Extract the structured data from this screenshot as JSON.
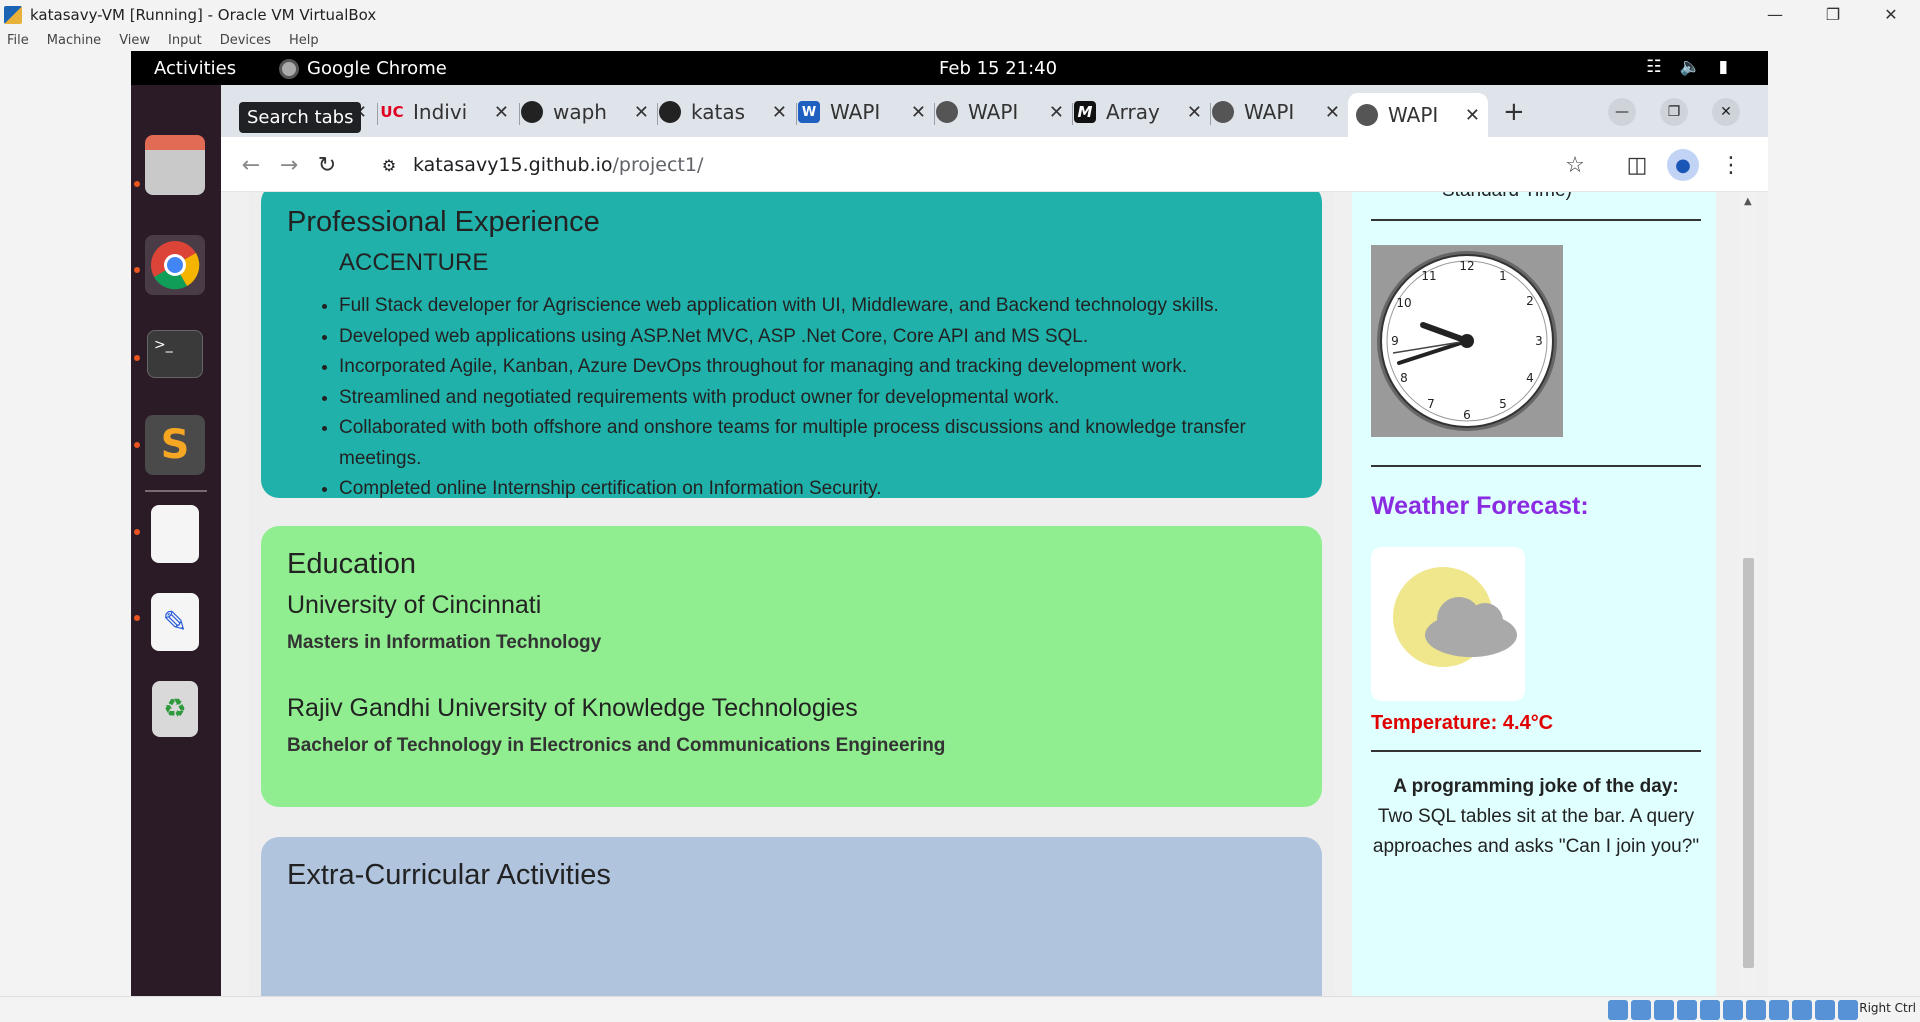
{
  "vbox": {
    "title": "katasavy-VM [Running] - Oracle VM VirtualBox",
    "menu": [
      "File",
      "Machine",
      "View",
      "Input",
      "Devices",
      "Help"
    ],
    "host_key": "Right Ctrl"
  },
  "gnome": {
    "activities": "Activities",
    "app_name": "Google Chrome",
    "datetime": "Feb 15  21:40"
  },
  "chrome": {
    "tooltip": "Search tabs",
    "tabs": [
      {
        "label": "",
        "icon": "blank"
      },
      {
        "label": "Indivi",
        "icon": "uc-logo"
      },
      {
        "label": "waph",
        "icon": "github-icon"
      },
      {
        "label": "katas",
        "icon": "github-icon"
      },
      {
        "label": "WAPI",
        "icon": "word-icon"
      },
      {
        "label": "WAPI",
        "icon": "globe-icon"
      },
      {
        "label": "Array",
        "icon": "m-icon"
      },
      {
        "label": "WAPI",
        "icon": "globe-icon"
      },
      {
        "label": "WAPI",
        "icon": "globe-icon"
      }
    ],
    "url_host": "katasavy15.github.io",
    "url_path": "/project1/"
  },
  "page": {
    "experience": {
      "heading": "Professional Experience",
      "company": "ACCENTURE",
      "items": [
        "Full Stack developer for Agriscience web application with UI, Middleware, and Backend technology skills.",
        "Developed web applications using ASP.Net MVC, ASP .Net Core, Core API and MS SQL.",
        "Incorporated Agile, Kanban, Azure DevOps throughout for managing and tracking development work.",
        "Streamlined and negotiated requirements with product owner for developmental work.",
        "Collaborated with both offshore and onshore teams for multiple process discussions and knowledge transfer meetings.",
        "Completed online Internship certification on Information Security."
      ]
    },
    "education": {
      "heading": "Education",
      "schools": [
        {
          "name": "University of Cincinnati",
          "degree": "Masters in Information Technology"
        },
        {
          "name": "Rajiv Gandhi University of Knowledge Technologies",
          "degree": "Bachelor of Technology in Electronics and Communications Engineering"
        }
      ]
    },
    "extra": {
      "heading": "Extra-Curricular Activities"
    },
    "sidebar": {
      "cut_text": "Standard Time)",
      "weather_title": "Weather Forecast:",
      "temperature": "Temperature: 4.4°C",
      "joke_title": "A programming joke of the day:",
      "joke_text": "Two SQL tables sit at the bar. A query approaches and asks \"Can I join you?\""
    }
  },
  "colors": {
    "experience_bg": "#20b2aa",
    "education_bg": "#90ee90",
    "extra_bg": "#b0c4de",
    "sidebar_bg": "#e0ffff",
    "weather_title": "#8a2be2",
    "temperature": "#e00000"
  }
}
